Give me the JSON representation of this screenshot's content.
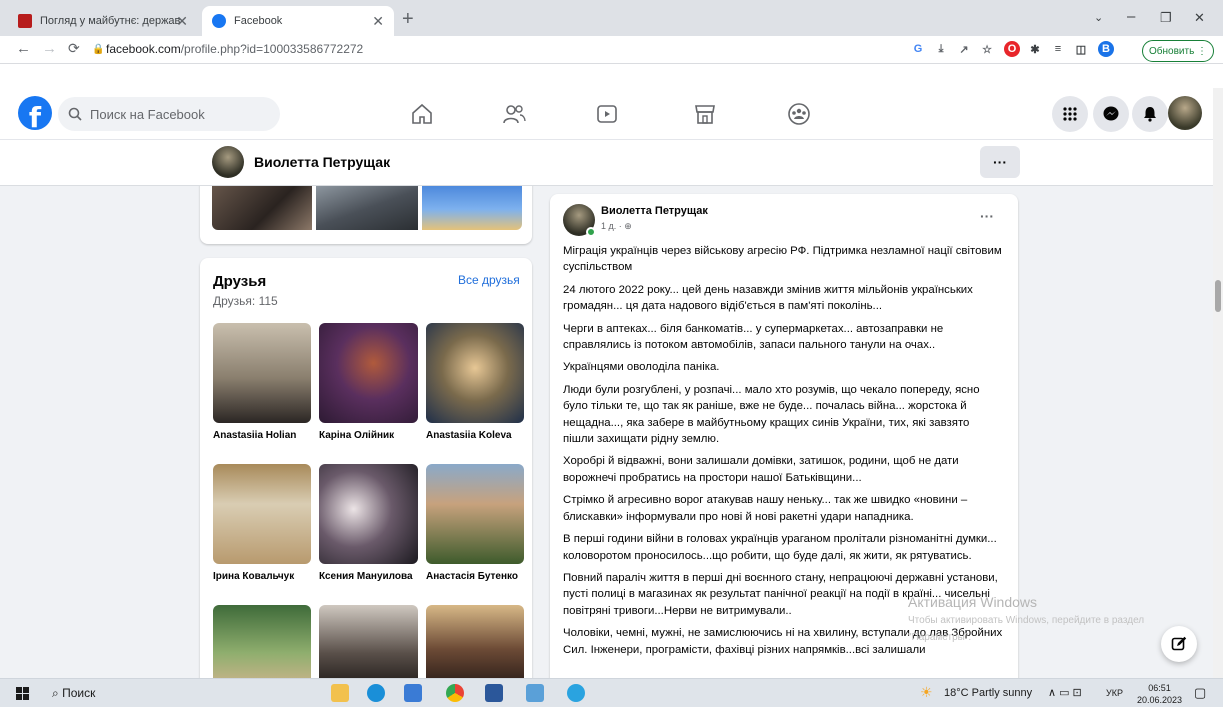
{
  "browser": {
    "tabs": [
      {
        "title": "Погляд у майбутнє: державна п",
        "active": false
      },
      {
        "title": "Facebook",
        "active": true
      }
    ],
    "url_host": "facebook.com",
    "url_path": "/profile.php?id=100033586772272",
    "update_label": "Обновить",
    "profile_initial": "В"
  },
  "header": {
    "logo": "f",
    "search_placeholder": "Поиск на Facebook"
  },
  "profile": {
    "name": "Виолетта Петрущак",
    "more": "···"
  },
  "friends": {
    "title": "Друзья",
    "count": "Друзья: 115",
    "all_link": "Все друзья",
    "items": [
      {
        "name": "Anastasiia Holian"
      },
      {
        "name": "Каріна Олійник"
      },
      {
        "name": "Anastasiia Koleva"
      },
      {
        "name": "Ірина Ковальчук"
      },
      {
        "name": "Ксения Мануилова"
      },
      {
        "name": "Анастасія Бутенко"
      }
    ]
  },
  "post": {
    "author": "Виолетта Петрущак",
    "time": "1 д. ·",
    "more": "···",
    "paragraphs": [
      "Міграція українців через військову агресію РФ. Підтримка незламної нації світовим суспільством",
      "24 лютого 2022 року... цей день назавжди змінив життя мільйонів українських громадян... ця дата надового відіб'ється в пам'яті поколінь...",
      "Черги в аптеках... біля банкоматів... у супермаркетах... автозаправки не справлялись із потоком автомобілів, запаси пального танули на очах..",
      "Українцями оволоділа паніка.",
      "Люди були розгублені, у розпачі... мало хто розумів, що чекало попереду, ясно було тільки те, що так як раніше, вже не буде... почалась війна... жорстока й нещадна..., яка забере в майбутньому кращих синів України, тих, які завзято пішли захищати рідну землю.",
      "Хоробрі й відважні, вони залишали домівки, затишок, родини, щоб не дати ворожнечі пробратись на простори нашої Батьківщини...",
      "Стрімко й агресивно ворог атакував нашу неньку... так же швидко «новини – блискавки» інформували про нові й нові ракетні удари нападника.",
      "В перші години війни в головах українців ураганом пролітали різноманітні думки... коловоротом проносилось...що робити, що буде далі, як жити, як рятуватись.",
      "Повний параліч життя в перші дні воєнного стану, непрацюючі державні установи, пусті полиці в магазинах як результат панічної реакції на події в країні... чисельні повітряні тривоги...Нерви не витримували..",
      "Чоловіки, чемні, мужні, не замислюючись ні на хвилину, вступали до лав Збройних Сил. Інженери, програмісти, фахівці різних напрямків...всі залишали"
    ]
  },
  "watermark": {
    "title": "Активация Windows",
    "line1": "Чтобы активировать Windows, перейдите в раздел",
    "line2": "\"Параметры\"."
  },
  "taskbar": {
    "search": "Поиск",
    "weather": "18°C  Partly sunny",
    "lang": "УКР",
    "time": "06:51",
    "date": "20.06.2023"
  },
  "colors": {
    "fb_blue": "#1877f2",
    "link": "#216fdb",
    "bg": "#f0f2f5"
  }
}
